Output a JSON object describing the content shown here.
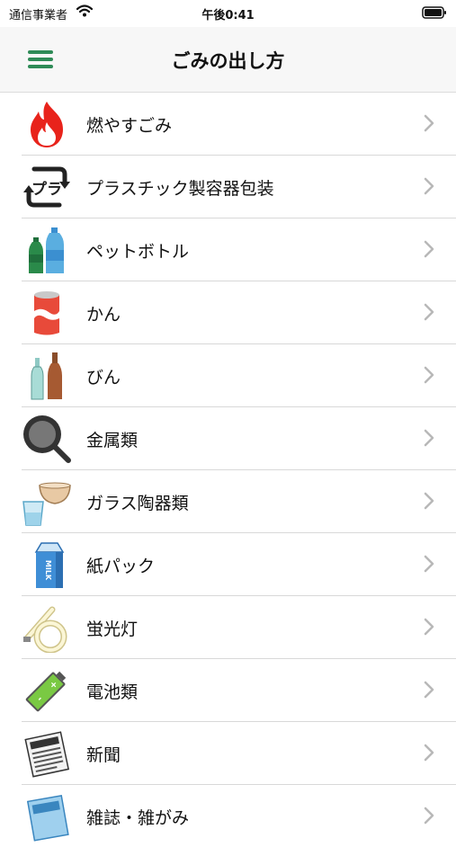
{
  "status_bar": {
    "carrier": "通信事業者",
    "time": "午後0:41"
  },
  "header": {
    "title": "ごみの出し方"
  },
  "categories": [
    {
      "label": "燃やすごみ",
      "icon": "flame-icon"
    },
    {
      "label": "プラスチック製容器包装",
      "icon": "plastic-recycle-icon"
    },
    {
      "label": "ペットボトル",
      "icon": "pet-bottle-icon"
    },
    {
      "label": "かん",
      "icon": "can-icon"
    },
    {
      "label": "びん",
      "icon": "glass-bottle-icon"
    },
    {
      "label": "金属類",
      "icon": "frying-pan-icon"
    },
    {
      "label": "ガラス陶器類",
      "icon": "bowl-and-glass-icon"
    },
    {
      "label": "紙パック",
      "icon": "milk-carton-icon"
    },
    {
      "label": "蛍光灯",
      "icon": "fluorescent-lamp-icon"
    },
    {
      "label": "電池類",
      "icon": "battery-icon"
    },
    {
      "label": "新聞",
      "icon": "newspaper-icon"
    },
    {
      "label": "雑誌・雑がみ",
      "icon": "magazine-icon"
    }
  ],
  "colors": {
    "accent": "#2e8b57",
    "nav_background": "#f7f7f7",
    "divider": "#d8d8d8",
    "chevron": "#b8b8b8"
  },
  "icon_text": {
    "milk": "MILK"
  }
}
